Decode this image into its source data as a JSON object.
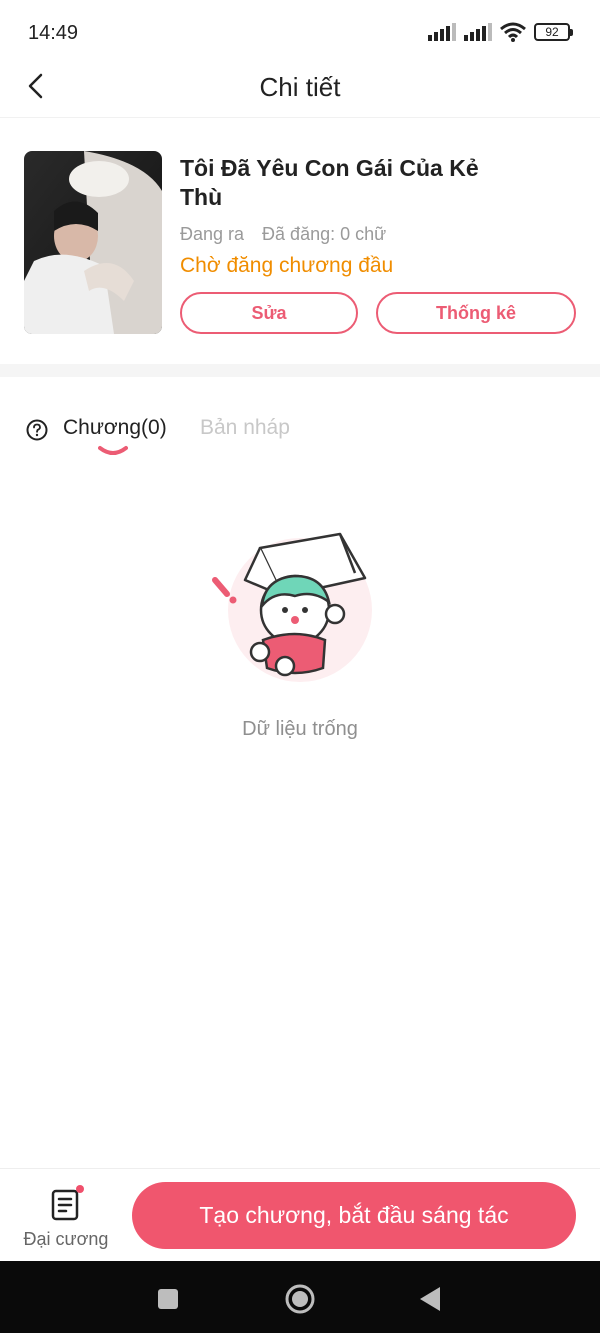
{
  "status_bar": {
    "time": "14:49",
    "battery": "92"
  },
  "header": {
    "title": "Chi tiết"
  },
  "book": {
    "title": "Tôi Đã Yêu Con Gái Của Kẻ Thù",
    "state": "Đang ra",
    "word_count": "Đã đăng: 0 chữ",
    "status": "Chờ đăng chương đầu",
    "edit_label": "Sửa",
    "stats_label": "Thống kê"
  },
  "tabs": [
    {
      "label": "Chương(0)",
      "active": true
    },
    {
      "label": "Bản nháp",
      "active": false
    }
  ],
  "empty": {
    "message": "Dữ liệu trống"
  },
  "bottom": {
    "outline_label": "Đại cương",
    "create_label": "Tạo chương, bắt đầu sáng tác"
  },
  "colors": {
    "accent": "#f0566e",
    "status_orange": "#f08d00",
    "muted": "#9a9a9a"
  },
  "icons": [
    "back-icon",
    "signal-icon",
    "wifi-icon",
    "battery-icon",
    "help-icon",
    "outline-icon",
    "nav-recent-icon",
    "nav-home-icon",
    "nav-back-icon"
  ]
}
